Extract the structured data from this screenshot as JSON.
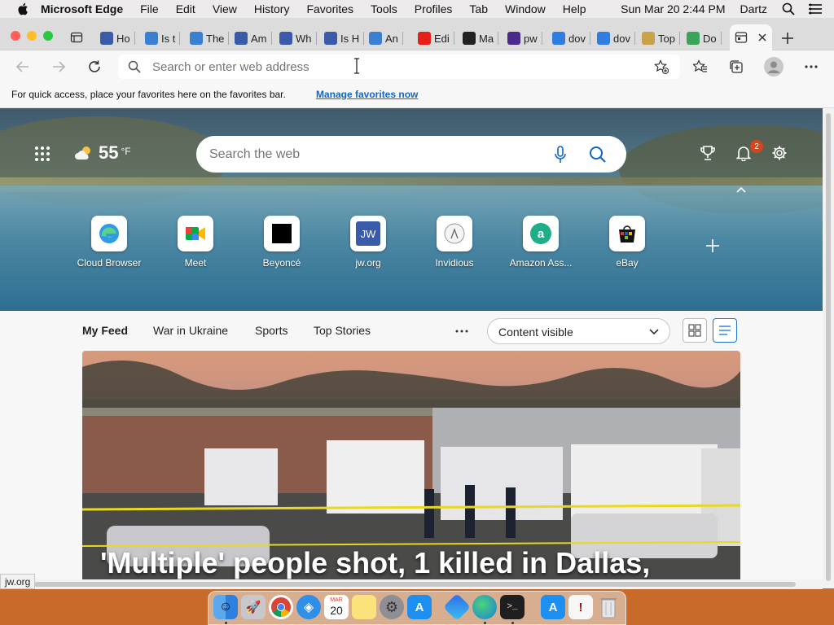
{
  "menubar": {
    "app_name": "Microsoft Edge",
    "menus": [
      "File",
      "Edit",
      "View",
      "History",
      "Favorites",
      "Tools",
      "Profiles",
      "Tab",
      "Window",
      "Help"
    ],
    "clock": "Sun Mar 20  2:44 PM",
    "user": "Dartz"
  },
  "tabs": [
    {
      "label": "Ho",
      "icon": "jw-icon",
      "color": "#3a5ba8"
    },
    {
      "label": "Is t",
      "icon": "page-icon",
      "color": "#3b7fd1"
    },
    {
      "label": "The",
      "icon": "page-icon",
      "color": "#3b7fd1"
    },
    {
      "label": "Am",
      "icon": "jw-icon",
      "color": "#3a5ba8"
    },
    {
      "label": "Wh",
      "icon": "jw-icon",
      "color": "#3a5ba8"
    },
    {
      "label": "Is H",
      "icon": "jw-icon",
      "color": "#3a5ba8"
    },
    {
      "label": "An",
      "icon": "page-icon",
      "color": "#3b7fd1"
    },
    {
      "label": "Edi",
      "icon": "youtube-icon",
      "color": "#e62117"
    },
    {
      "label": "Ma",
      "icon": "wikipedia-icon",
      "color": "#222222"
    },
    {
      "label": "pw",
      "icon": "hash-icon",
      "color": "#4a2a8a"
    },
    {
      "label": "dov",
      "icon": "bing-icon",
      "color": "#2f7de0"
    },
    {
      "label": "dov",
      "icon": "bing-icon",
      "color": "#2f7de0"
    },
    {
      "label": "Top",
      "icon": "p-icon",
      "color": "#c9a24a"
    },
    {
      "label": "Do",
      "icon": "chrome-icon",
      "color": "#3aa55a"
    }
  ],
  "toolbar": {
    "address_placeholder": "Search or enter web address"
  },
  "favorites_bar": {
    "hint": "For quick access, place your favorites here on the favorites bar.",
    "manage_link": "Manage favorites now"
  },
  "hero": {
    "temperature": "55",
    "unit": "°F",
    "search_placeholder": "Search the web",
    "notification_count": "2",
    "quick_links": [
      {
        "label": "Cloud Browser",
        "icon": "edge-icon"
      },
      {
        "label": "Meet",
        "icon": "meet-icon"
      },
      {
        "label": "Beyoncé",
        "icon": "beyonce-icon"
      },
      {
        "label": "jw.org",
        "icon": "jw-icon"
      },
      {
        "label": "Invidious",
        "icon": "invidious-icon"
      },
      {
        "label": "Amazon Ass...",
        "icon": "amazon-icon"
      },
      {
        "label": "eBay",
        "icon": "ebay-icon"
      }
    ]
  },
  "feed": {
    "tabs": [
      "My Feed",
      "War in Ukraine",
      "Sports",
      "Top Stories"
    ],
    "content_select": "Content visible",
    "headline": "'Multiple' people shot, 1 killed in Dallas,"
  },
  "status_bar": {
    "url": "jw.org"
  },
  "dock": {
    "calendar_month": "MAR",
    "calendar_day": "20"
  },
  "colors": {
    "accent": "#1466c6",
    "badge": "#d9441c"
  }
}
